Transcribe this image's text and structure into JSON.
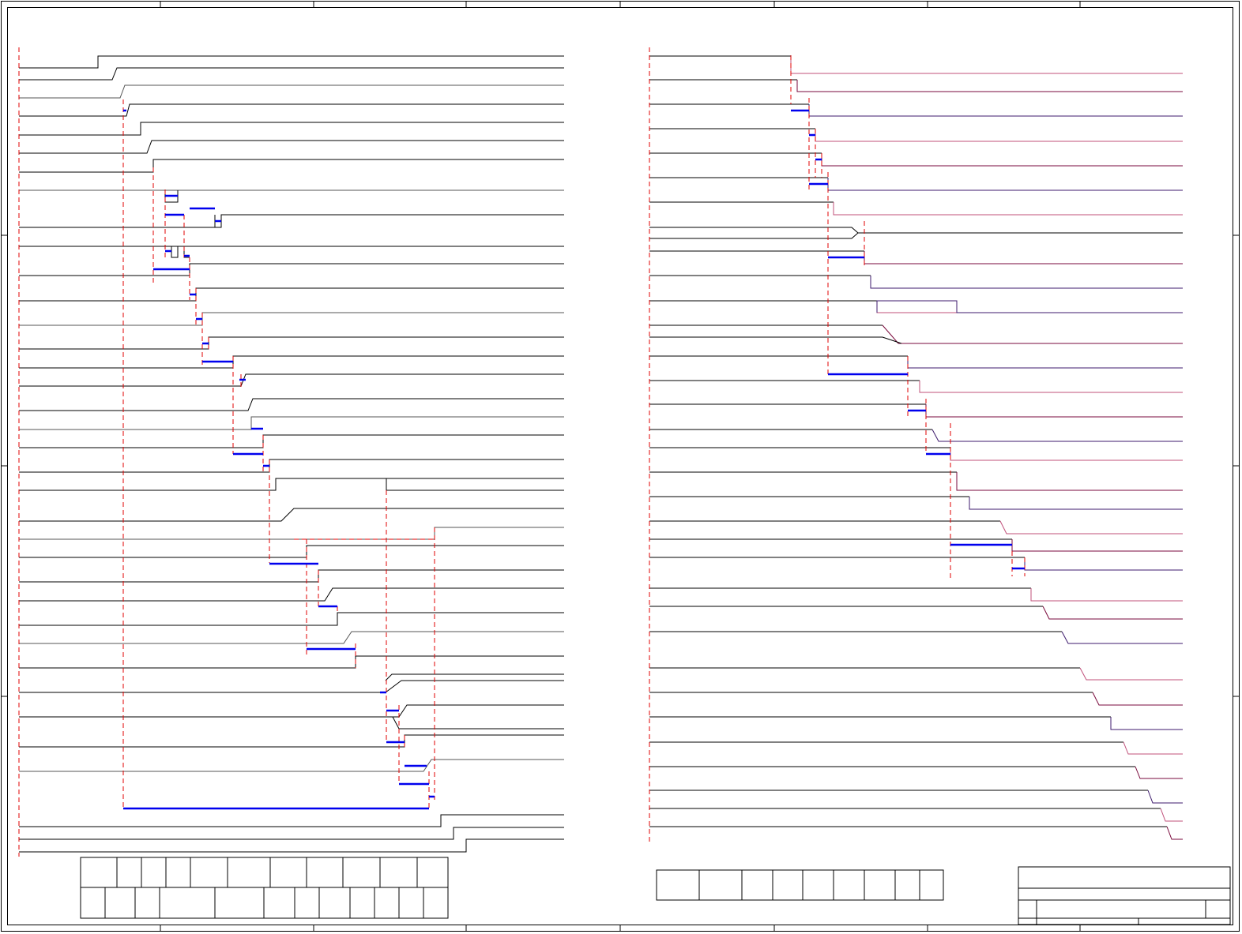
{
  "sheet": {
    "title": "",
    "colors": {
      "frame": "#000000",
      "signal": "#000000",
      "signal_dim": "#555555",
      "signal_alt": "#7a0a3c",
      "signal_pink": "#c0507a",
      "signal_purple": "#3c1a6c",
      "timing_marker": "#e00000",
      "timing_bar": "#0000ee"
    },
    "border_markers": [
      "top-zone-ticks",
      "bottom-zone-ticks",
      "left-zone-ticks",
      "right-zone-ticks"
    ]
  },
  "left_diagram": {
    "label": "",
    "signal_count": 47,
    "note": ""
  },
  "right_diagram": {
    "label": "",
    "signal_count": 38
  },
  "left_table": {
    "header_cells": 10,
    "body_cells": 13
  },
  "right_table": {
    "cells": 9
  },
  "title_block": {
    "title": "",
    "drawing_no": "",
    "sheet": ""
  }
}
